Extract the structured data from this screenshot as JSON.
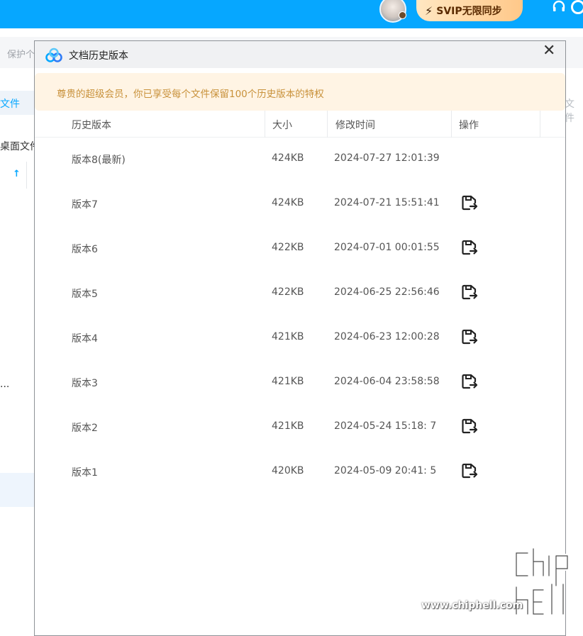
{
  "app": {
    "svip_label": "SVIP无限同步",
    "search_placeholder": "保护个",
    "tab_left": "文件",
    "tab_right": "文件",
    "desktop_folder": "桌面文件",
    "ellipsis": "...",
    "sort_arrow": "↑"
  },
  "dialog": {
    "title": "文档历史版本",
    "close_label": "✕",
    "notice": "尊贵的超级会员，你已享受每个文件保留100个历史版本的特权",
    "columns": [
      "历史版本",
      "大小",
      "修改时间",
      "操作"
    ],
    "rows": [
      {
        "version": "版本8(最新)",
        "size": "424KB",
        "time": "2024-07-27 12:01:39",
        "has_restore": false
      },
      {
        "version": "版本7",
        "size": "424KB",
        "time": "2024-07-21 15:51:41",
        "has_restore": true
      },
      {
        "version": "版本6",
        "size": "422KB",
        "time": "2024-07-01 00:01:55",
        "has_restore": true
      },
      {
        "version": "版本5",
        "size": "422KB",
        "time": "2024-06-25 22:56:46",
        "has_restore": true
      },
      {
        "version": "版本4",
        "size": "421KB",
        "time": "2024-06-23 12:00:28",
        "has_restore": true
      },
      {
        "version": "版本3",
        "size": "421KB",
        "time": "2024-06-04 23:58:58",
        "has_restore": true
      },
      {
        "version": "版本2",
        "size": "421KB",
        "time": "2024-05-24 15:18: 7",
        "has_restore": true
      },
      {
        "version": "版本1",
        "size": "420KB",
        "time": "2024-05-09 20:41: 5",
        "has_restore": true
      }
    ],
    "restore_icon": "restore-version-icon"
  },
  "watermark": {
    "url": "www.chiphell.com",
    "logo_text": "chip hell"
  },
  "colors": {
    "topbar": "#06a7ff",
    "notice_bg": "#fff4e4",
    "notice_text": "#c8913a",
    "svip_gradient_start": "#ffe7c2",
    "svip_gradient_end": "#ffc889"
  }
}
